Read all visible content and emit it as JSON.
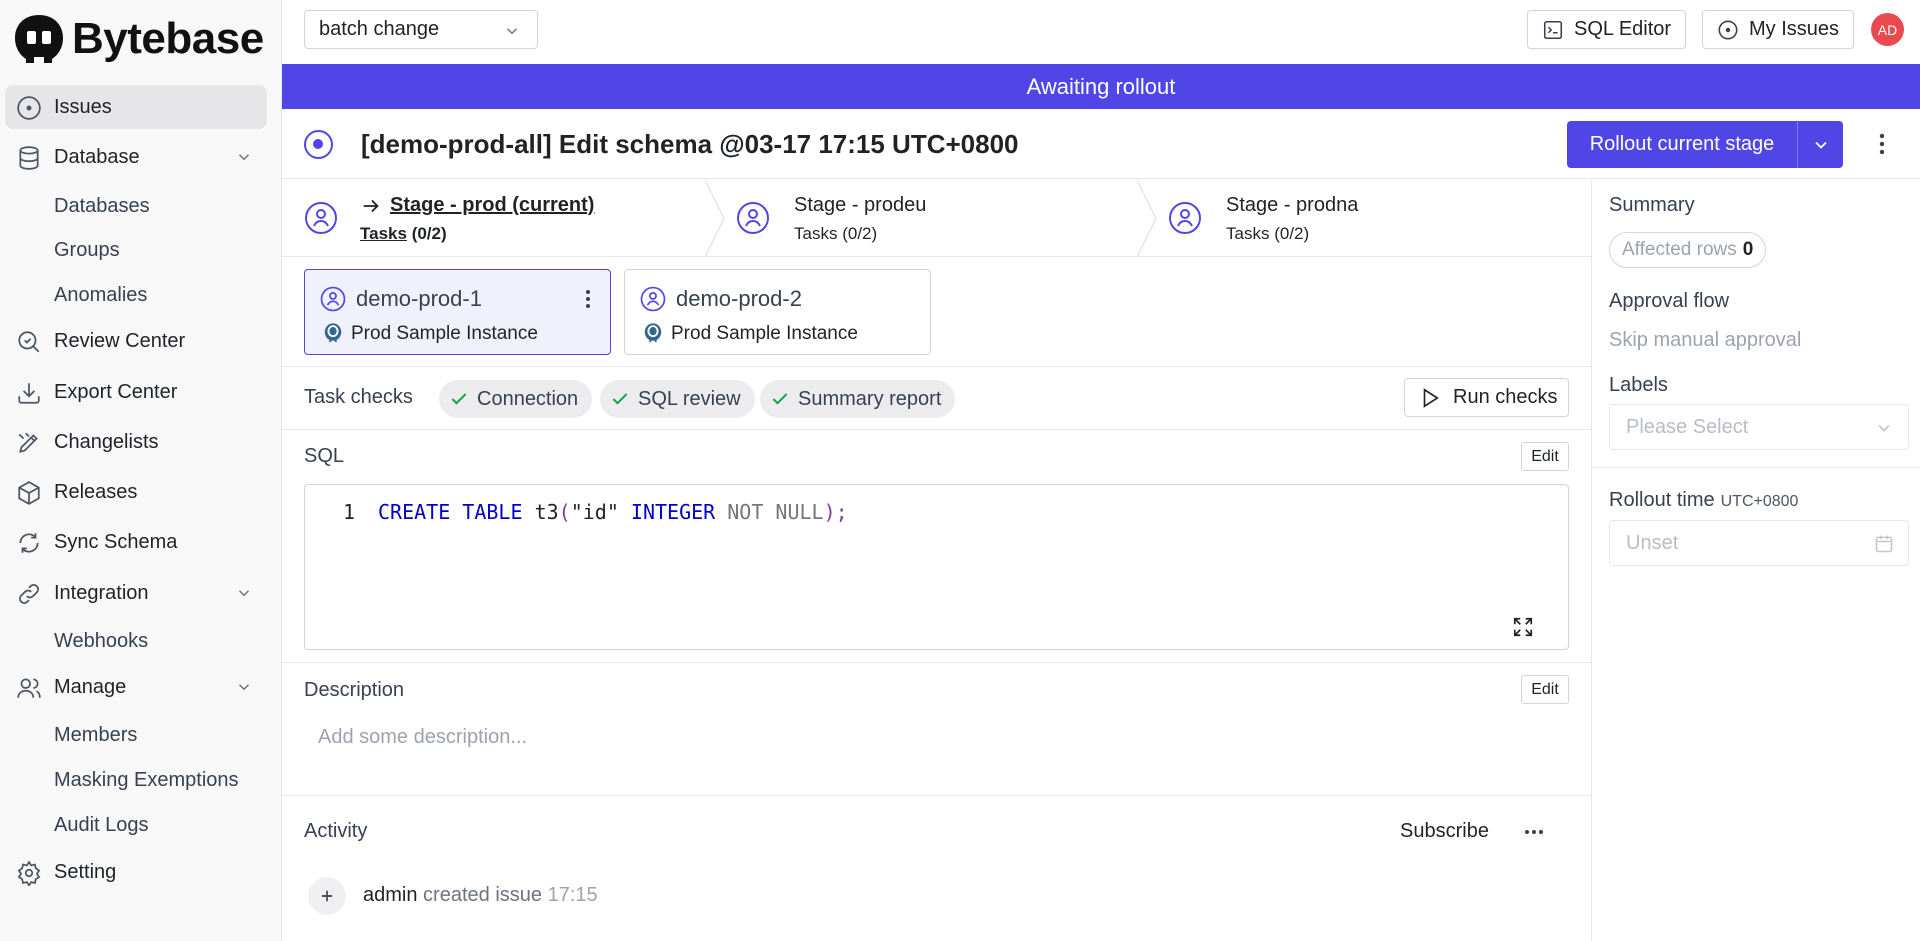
{
  "app": {
    "name": "Bytebase"
  },
  "sidebar": {
    "items": [
      {
        "label": "Issues",
        "icon": "issue-circle-icon",
        "active": true
      },
      {
        "label": "Database",
        "icon": "database-icon",
        "expandable": true,
        "children": [
          "Databases",
          "Groups",
          "Anomalies"
        ]
      },
      {
        "label": "Review Center",
        "icon": "review-search-icon"
      },
      {
        "label": "Export Center",
        "icon": "download-icon"
      },
      {
        "label": "Changelists",
        "icon": "changelist-icon"
      },
      {
        "label": "Releases",
        "icon": "package-icon"
      },
      {
        "label": "Sync Schema",
        "icon": "sync-icon"
      },
      {
        "label": "Integration",
        "icon": "link-icon",
        "expandable": true,
        "children": [
          "Webhooks"
        ]
      },
      {
        "label": "Manage",
        "icon": "users-icon",
        "expandable": true,
        "children": [
          "Members",
          "Masking Exemptions",
          "Audit Logs"
        ]
      },
      {
        "label": "Setting",
        "icon": "gear-icon"
      }
    ]
  },
  "header": {
    "project_select": "batch change",
    "sql_editor": "SQL Editor",
    "my_issues": "My Issues",
    "avatar_initials": "AD"
  },
  "banner": {
    "text": "Awaiting rollout",
    "color": "#4f46e5"
  },
  "issue": {
    "title": "[demo-prod-all] Edit schema @03-17 17:15 UTC+0800",
    "primary_action": "Rollout current stage"
  },
  "stages": [
    {
      "name": "Stage - prod (current)",
      "tasks_label": "Tasks",
      "tasks_count": "(0/2)",
      "current": true
    },
    {
      "name": "Stage - prodeu",
      "tasks_label": "Tasks",
      "tasks_count": "(0/2)"
    },
    {
      "name": "Stage - prodna",
      "tasks_label": "Tasks",
      "tasks_count": "(0/2)"
    }
  ],
  "tasks": [
    {
      "name": "demo-prod-1",
      "instance": "Prod Sample Instance",
      "selected": true
    },
    {
      "name": "demo-prod-2",
      "instance": "Prod Sample Instance"
    }
  ],
  "task_checks": {
    "label": "Task checks",
    "checks": [
      "Connection",
      "SQL review",
      "Summary report"
    ],
    "run_button": "Run checks"
  },
  "sql": {
    "label": "SQL",
    "edit": "Edit",
    "line_number": "1",
    "tokens": {
      "create": "CREATE",
      "table": "TABLE",
      "name": "t3",
      "open": "(",
      "col": "\"id\"",
      "type": "INTEGER",
      "not_null": "NOT NULL",
      "close": ");"
    }
  },
  "description": {
    "label": "Description",
    "edit": "Edit",
    "placeholder": "Add some description..."
  },
  "activity": {
    "label": "Activity",
    "subscribe": "Subscribe",
    "entries": [
      {
        "who": "admin",
        "action": "created issue",
        "time": "17:15"
      }
    ]
  },
  "summary_panel": {
    "summary_label": "Summary",
    "affected_rows_label": "Affected rows",
    "affected_rows_value": "0",
    "approval_flow_label": "Approval flow",
    "approval_flow_value": "Skip manual approval",
    "labels_label": "Labels",
    "labels_placeholder": "Please Select",
    "rollout_time_label": "Rollout time",
    "rollout_time_tz": "UTC+0800",
    "rollout_time_value": "Unset"
  }
}
